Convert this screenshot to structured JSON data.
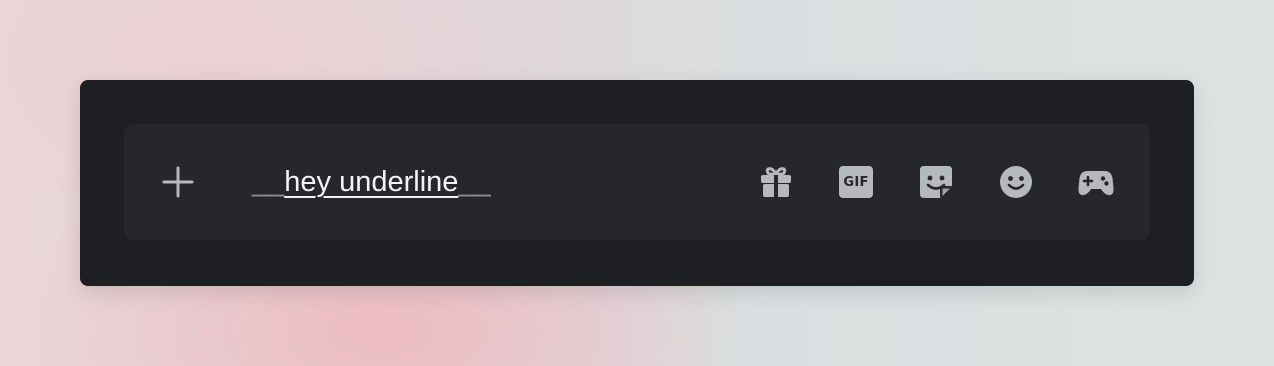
{
  "composer": {
    "message": {
      "open_marker": "__",
      "text": "hey underline",
      "close_marker": "__"
    },
    "actions": {
      "add": {
        "icon": "plus-icon"
      },
      "gift": {
        "icon": "gift-icon"
      },
      "gif": {
        "icon": "gif-icon",
        "label": "GIF"
      },
      "sticker": {
        "icon": "sticker-icon"
      },
      "emoji": {
        "icon": "smiley-icon"
      },
      "apps": {
        "icon": "gamepad-icon"
      }
    }
  },
  "colors": {
    "window_bg": "#1e1f22",
    "chatbar_bg": "#26272b",
    "icon": "#b5b8bd",
    "text": "#f2f3f5",
    "markdown_marker": "#8b8e93"
  }
}
